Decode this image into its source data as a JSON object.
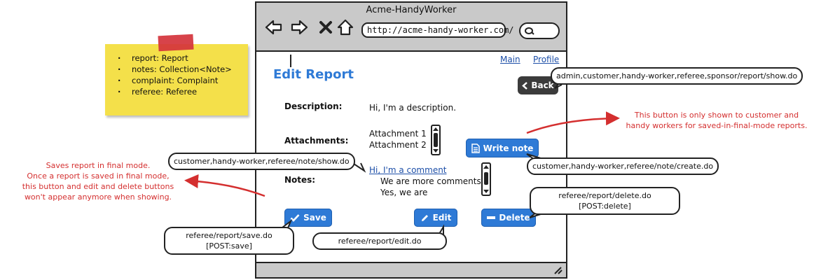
{
  "window": {
    "title": "Acme-HandyWorker",
    "url": "http://acme-handy-worker.com/"
  },
  "nav": {
    "main": "Main",
    "profile": "Profile"
  },
  "page": {
    "title": "Edit Report",
    "back_label": "Back",
    "description_label": "Description:",
    "description_value": "Hi, I'm a description.",
    "attachments_label": "Attachments:",
    "attachments": [
      "Attachment 1",
      "Attachment 2"
    ],
    "notes_label": "Notes:",
    "notes_link": "Hi, I'm a comment",
    "notes": [
      "We are more comments",
      "Yes, we are"
    ],
    "write_note_label": "Write note",
    "save_label": "Save",
    "edit_label": "Edit",
    "delete_label": "Delete"
  },
  "sticky_note": {
    "items": [
      "report: Report",
      "notes: Collection<Note>",
      "complaint: Complaint",
      "referee: Referee"
    ]
  },
  "callouts": {
    "back": "admin,customer,handy-worker,referee,sponsor/report/show.do",
    "note_show": "customer,handy-worker,referee/note/show.do",
    "note_create": "customer,handy-worker,referee/note/create.do",
    "delete_line1": "referee/report/delete.do",
    "delete_line2": "[POST:delete]",
    "save_line1": "referee/report/save.do",
    "save_line2": "[POST:save]",
    "edit": "referee/report/edit.do"
  },
  "annotations": {
    "save_note": [
      "Saves report in final mode.",
      "Once a report is saved in final mode,",
      "this button and edit and delete buttons",
      "won't appear anymore when showing."
    ],
    "write_note": [
      "This button is only shown to customer and",
      "handy workers for saved-in-final-mode reports."
    ]
  },
  "colors": {
    "accent": "#2e7ad6",
    "annotation_red": "#d42f2f",
    "sticky_yellow": "#f4e04a",
    "tape_red": "#d4333b",
    "chrome_gray": "#c9c9c9",
    "back_button": "#3b3b3b"
  },
  "icons": {
    "back": "arrow-left-icon",
    "forward": "arrow-right-icon",
    "stop": "close-icon",
    "home": "home-icon",
    "search": "search-icon",
    "write_note": "document-icon",
    "save": "checkmark-icon",
    "edit": "pencil-icon",
    "delete": "minus-icon",
    "resize": "resize-grip-icon"
  }
}
